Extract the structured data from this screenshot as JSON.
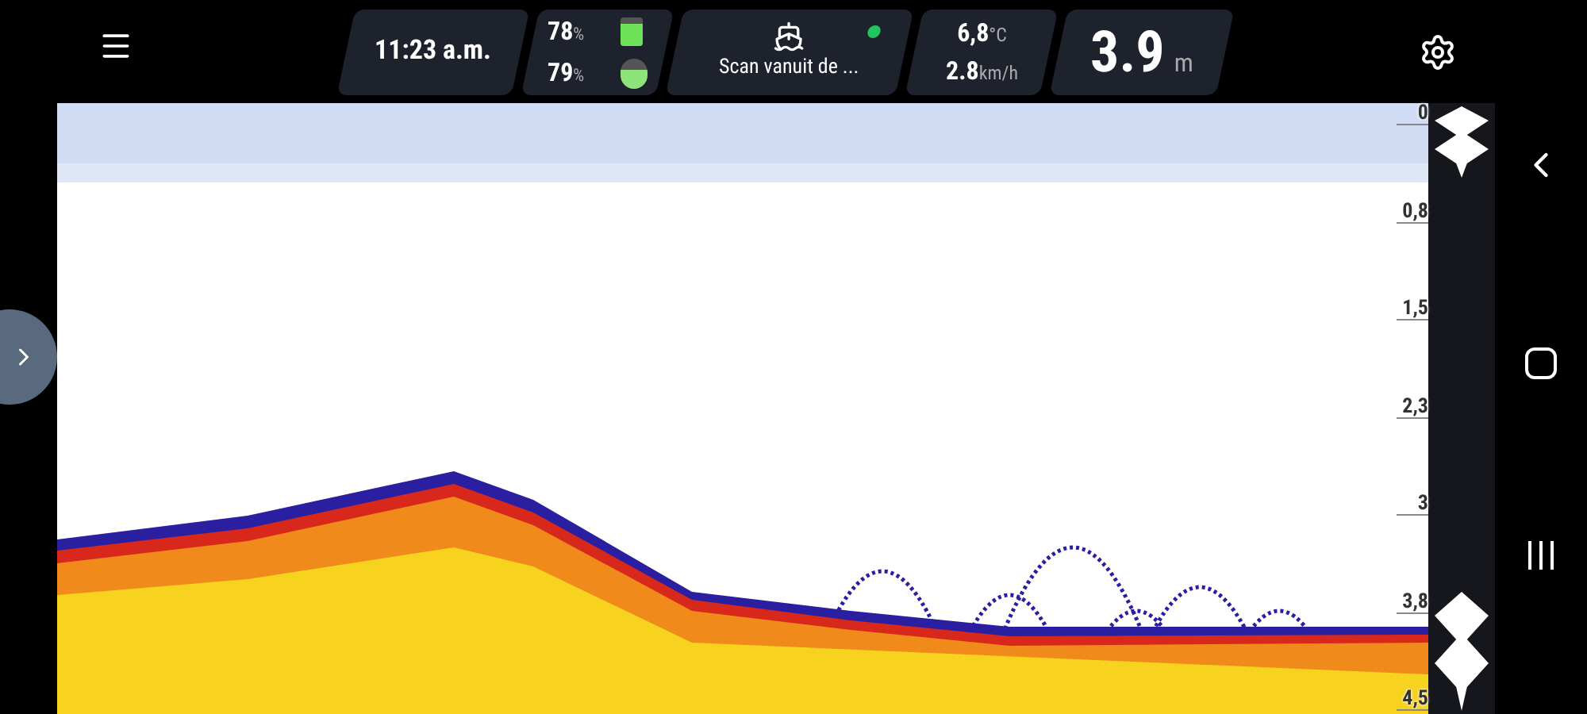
{
  "top_bar": {
    "time": "11:23 a.m.",
    "batteries": [
      {
        "kind": "phone",
        "value": "78",
        "unit": "%",
        "level": 0.78
      },
      {
        "kind": "sonar",
        "value": "79",
        "unit": "%",
        "level": 0.6
      }
    ],
    "device": {
      "name": "Scan vanuit de ...",
      "connected": true
    },
    "water_temp": {
      "value": "6,8",
      "unit": "°C"
    },
    "speed": {
      "value": "2.8",
      "unit": "km/h"
    },
    "depth": {
      "value": "3.9",
      "unit": "m"
    }
  },
  "depth_scale": [
    "0",
    "0,8",
    "1,5",
    "2,3",
    "3",
    "3,8",
    "4,5"
  ]
}
